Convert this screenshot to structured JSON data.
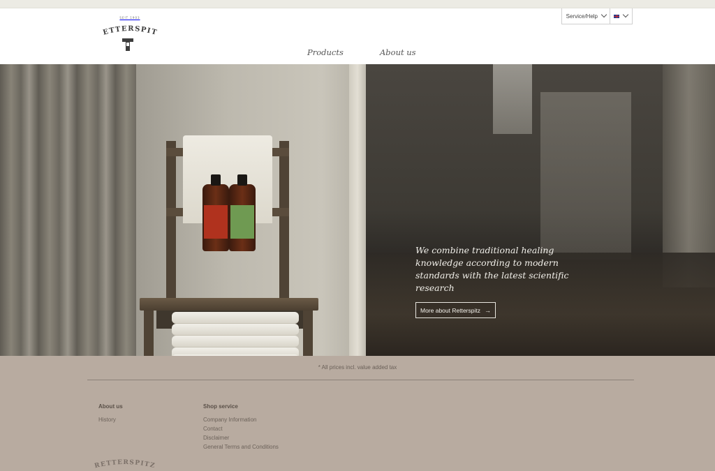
{
  "brand": {
    "since": "SEIT 1903",
    "name": "RETTERSPITZ"
  },
  "utility": {
    "service_label": "Service/Help",
    "language_flag": "uk-flag-icon"
  },
  "nav": {
    "items": [
      {
        "label": "Products"
      },
      {
        "label": "About us"
      }
    ]
  },
  "hero": {
    "headline": "We combine traditional healing knowledge according to modern standards with the latest scientific research",
    "cta_label": "More about Retterspitz",
    "cta_icon": "arrow-right-icon"
  },
  "footer": {
    "tax_note": "* All prices incl. value added tax",
    "columns": [
      {
        "title": "About us",
        "links": [
          "History"
        ]
      },
      {
        "title": "Shop service",
        "links": [
          "Company Information",
          "Contact",
          "Disclaimer",
          "General Terms and Conditions"
        ]
      }
    ],
    "logo_text": "RETTERSPITZ"
  },
  "colors": {
    "footer_bg": "#b8aba0",
    "bottle_red": "#b0321e",
    "bottle_green": "#6f9a52"
  }
}
